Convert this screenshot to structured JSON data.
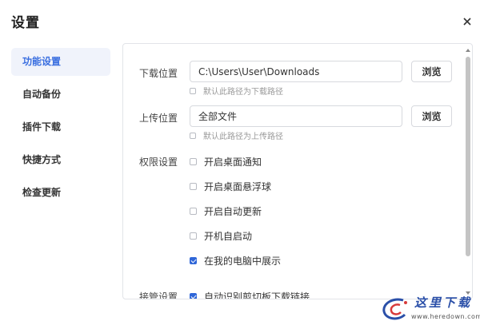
{
  "dialog": {
    "title": "设置"
  },
  "sidebar": {
    "items": [
      {
        "label": "功能设置"
      },
      {
        "label": "自动备份"
      },
      {
        "label": "插件下载"
      },
      {
        "label": "快捷方式"
      },
      {
        "label": "检查更新"
      }
    ]
  },
  "download": {
    "label": "下载位置",
    "path_value": "C:\\Users\\User\\Downloads",
    "browse_label": "浏览",
    "default_checkbox_label": "默认此路径为下载路径",
    "default_checked": false
  },
  "upload": {
    "label": "上传位置",
    "path_value": "全部文件",
    "browse_label": "浏览",
    "default_checkbox_label": "默认此路径为上传路径",
    "default_checked": false
  },
  "permissions": {
    "label": "权限设置",
    "options": [
      {
        "label": "开启桌面通知",
        "checked": false
      },
      {
        "label": "开启桌面悬浮球",
        "checked": false
      },
      {
        "label": "开启自动更新",
        "checked": false
      },
      {
        "label": "开机自启动",
        "checked": false
      },
      {
        "label": "在我的电脑中展示",
        "checked": true
      }
    ]
  },
  "takeover": {
    "label": "接管设置",
    "options": [
      {
        "label": "自动识别剪切板下载链接",
        "checked": true
      }
    ]
  },
  "watermark": {
    "text": "这里下载",
    "url": "www.heredown.com"
  },
  "colors": {
    "accent": "#2f66d8",
    "active_bg": "#f0f3fb",
    "border": "#e2e4e8"
  }
}
